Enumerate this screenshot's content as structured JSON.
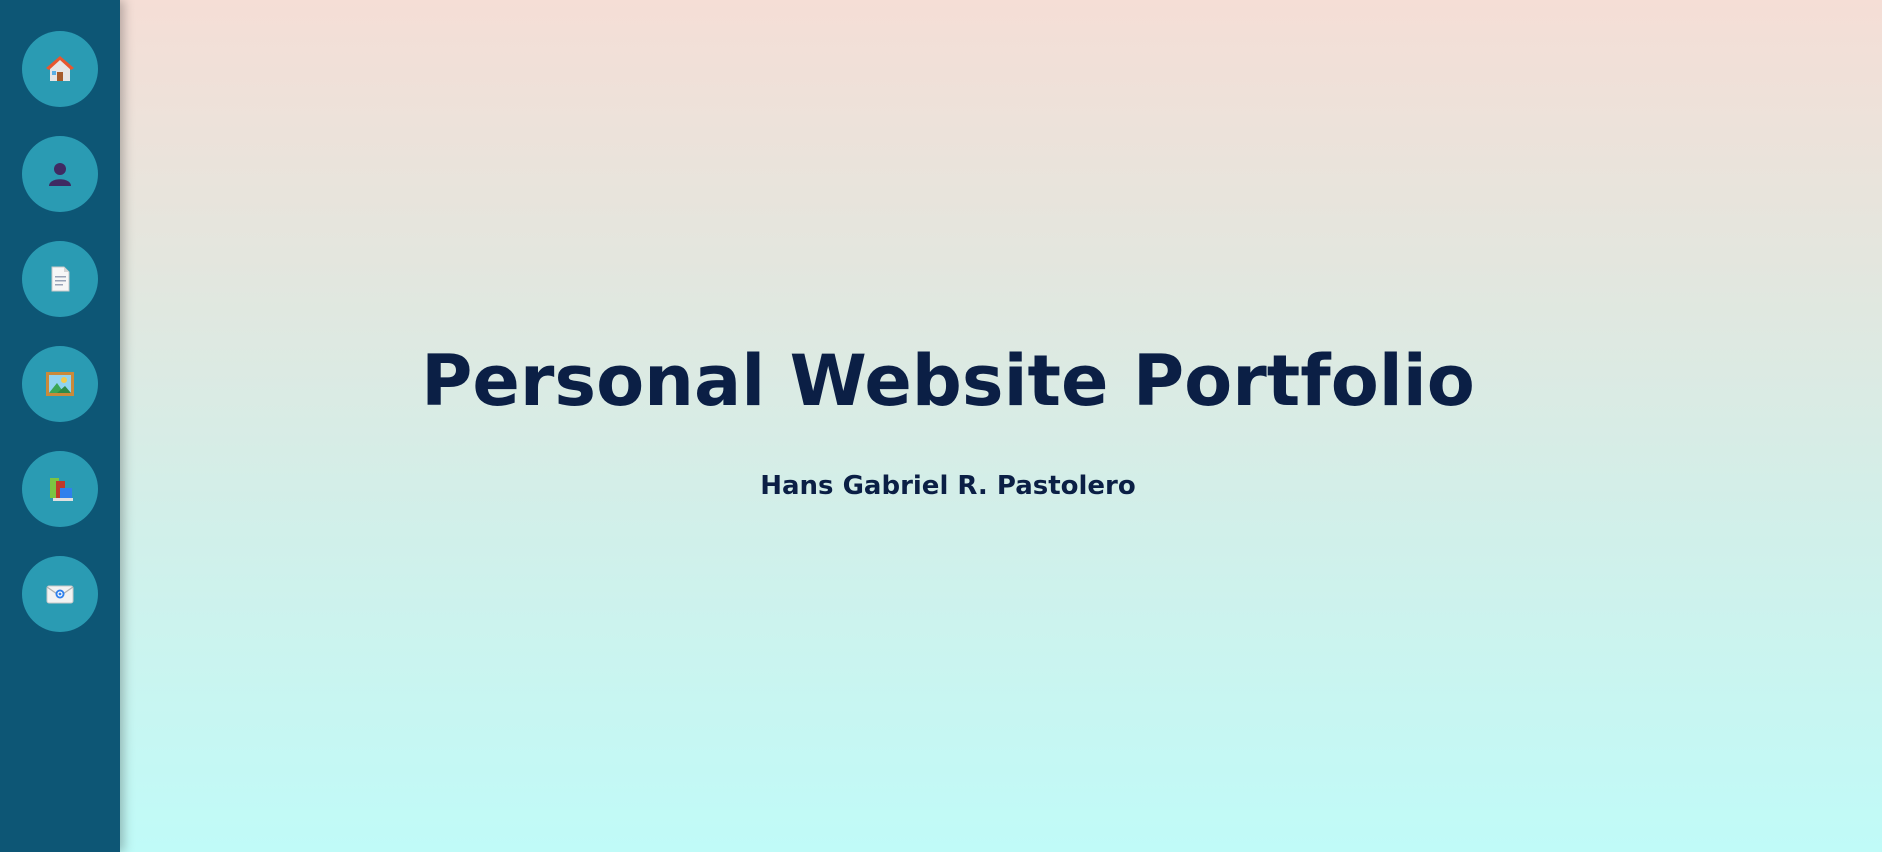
{
  "sidebar": {
    "background": "#0d5675",
    "button_color": "#2a9bb3",
    "items": [
      {
        "icon": "house-icon"
      },
      {
        "icon": "person-silhouette-icon"
      },
      {
        "icon": "document-icon"
      },
      {
        "icon": "framed-picture-icon"
      },
      {
        "icon": "books-icon"
      },
      {
        "icon": "envelope-icon"
      }
    ]
  },
  "hero": {
    "title": "Personal Website Portfolio",
    "subtitle": "Hans Gabriel R. Pastolero",
    "text_color": "#0b1f45"
  }
}
